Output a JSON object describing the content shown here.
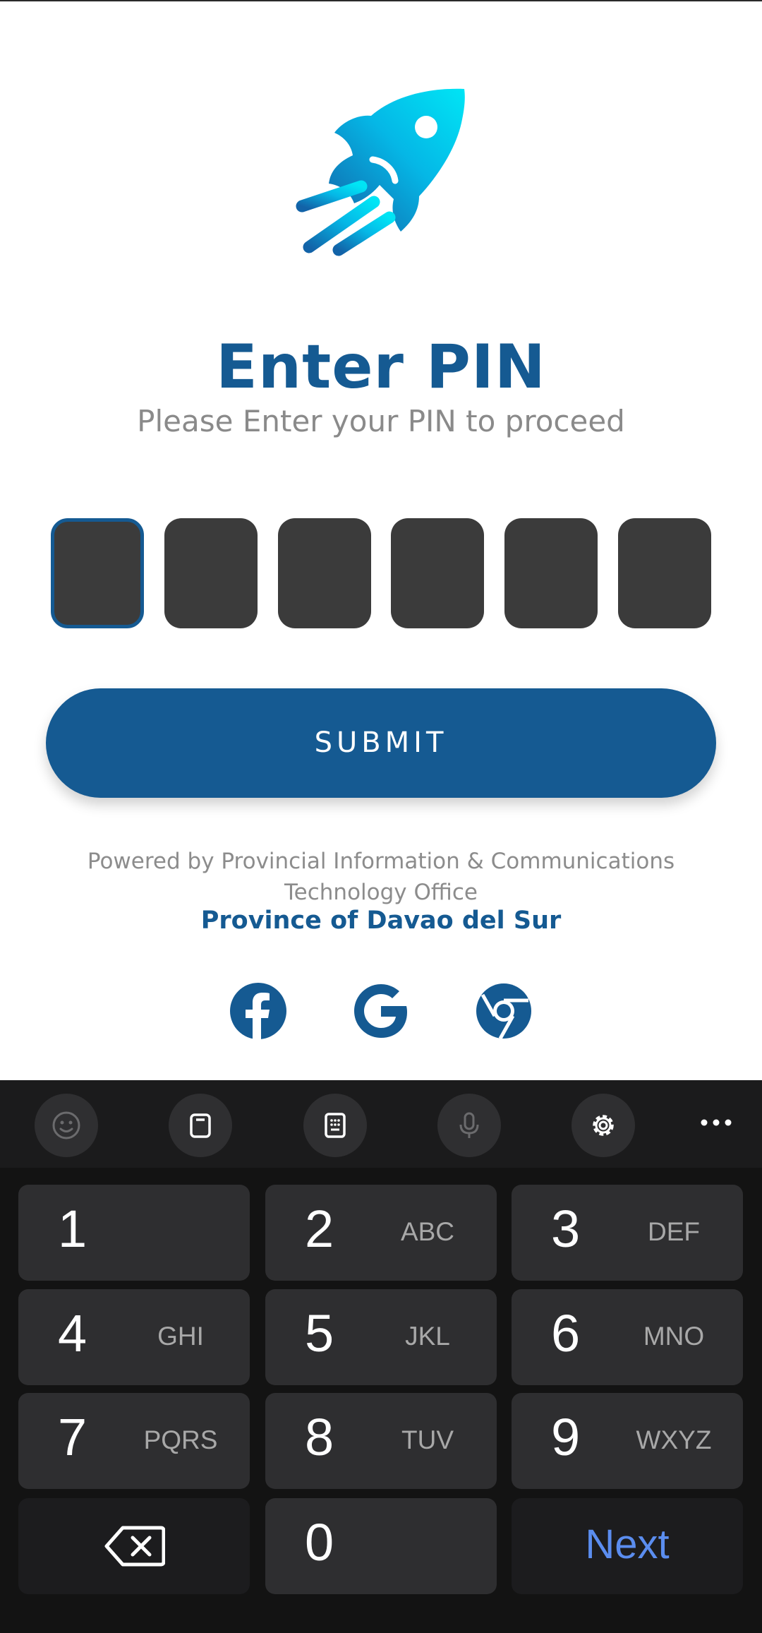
{
  "app": {
    "title": "Enter PIN",
    "subtitle": "Please Enter your PIN to proceed",
    "pin_length": 6,
    "submit_label": "SUBMIT",
    "powered_by": "Powered by Provincial Information & Communications Technology Office",
    "province": "Province of Davao del Sur",
    "brand_color": "#155a92",
    "icons": {
      "logo": "rocket-logo-icon",
      "social": [
        "facebook-icon",
        "google-icon",
        "chrome-icon"
      ]
    }
  },
  "keyboard": {
    "toolbar": [
      "emoji-icon",
      "clipboard-icon",
      "keypad-icon",
      "microphone-icon",
      "settings-icon",
      "more-icon"
    ],
    "keys": [
      {
        "num": "1",
        "letters": ""
      },
      {
        "num": "2",
        "letters": "ABC"
      },
      {
        "num": "3",
        "letters": "DEF"
      },
      {
        "num": "4",
        "letters": "GHI"
      },
      {
        "num": "5",
        "letters": "JKL"
      },
      {
        "num": "6",
        "letters": "MNO"
      },
      {
        "num": "7",
        "letters": "PQRS"
      },
      {
        "num": "8",
        "letters": "TUV"
      },
      {
        "num": "9",
        "letters": "WXYZ"
      },
      {
        "num": "0",
        "letters": ""
      }
    ],
    "next_label": "Next"
  }
}
